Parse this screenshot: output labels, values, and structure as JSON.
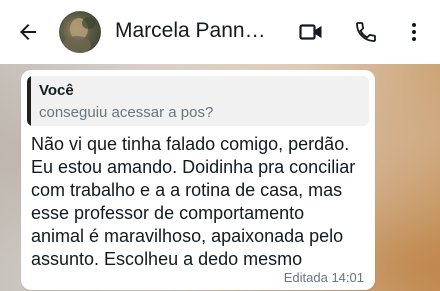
{
  "header": {
    "contact_name": "Marcela Pannain…",
    "icons": [
      "back-arrow-icon",
      "video-call-icon",
      "voice-call-icon",
      "more-options-icon"
    ]
  },
  "message": {
    "quoted_author": "Você",
    "quoted_text": "conseguiu acessar a pos?",
    "text": "Não vi que tinha falado comigo, perdão.\nEu estou amando. Doidinha pra conciliar\ncom trabalho e a a rotina de casa, mas\nesse professor de comportamento\nanimal é maravilhoso, apaixonada pelo\nassunto. Escolheu a dedo mesmo",
    "edited_label": "Editada",
    "time": "14:01"
  },
  "colors": {
    "header_bg": "#ffffff",
    "text_primary": "#111b21",
    "text_secondary": "#667781",
    "quote_bg": "#f1f1f1",
    "quote_bar": "#202020"
  }
}
